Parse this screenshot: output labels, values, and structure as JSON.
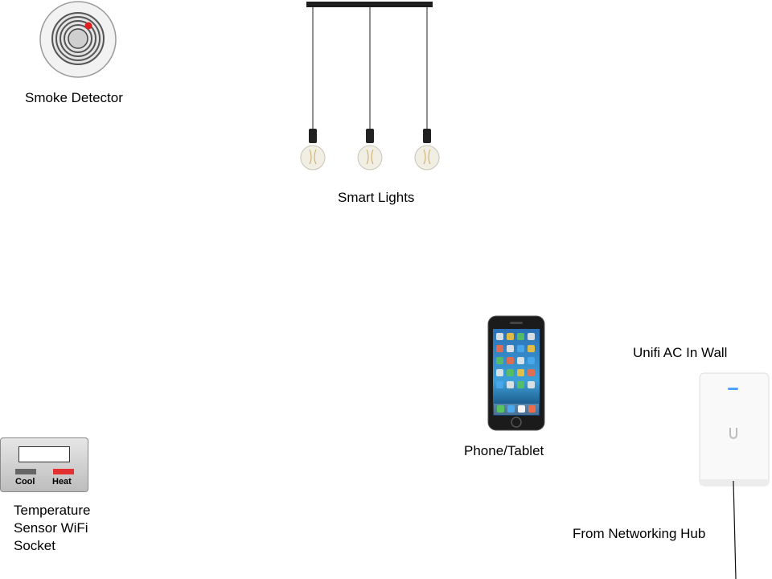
{
  "nodes": {
    "smoke_detector": {
      "label": "Smoke Detector",
      "icon": "smoke-detector-icon"
    },
    "smart_lights": {
      "label": "Smart Lights",
      "icon": "pendant-lights-icon"
    },
    "phone_tablet": {
      "label": "Phone/Tablet",
      "icon": "smartphone-icon"
    },
    "unifi": {
      "label": "Unifi AC In Wall",
      "icon": "wall-access-point-icon"
    },
    "temperature": {
      "label_lines": [
        "Temperature",
        "Sensor WiFi",
        "Socket"
      ],
      "icon": "thermostat-icon",
      "cool_label": "Cool",
      "heat_label": "Heat"
    },
    "networking_hub": {
      "label": "From Networking Hub"
    }
  },
  "colors": {
    "alarm_red": "#e02020",
    "heat_red": "#e33030",
    "cool_gray": "#666666",
    "ap_led_blue": "#4fa3ff"
  }
}
